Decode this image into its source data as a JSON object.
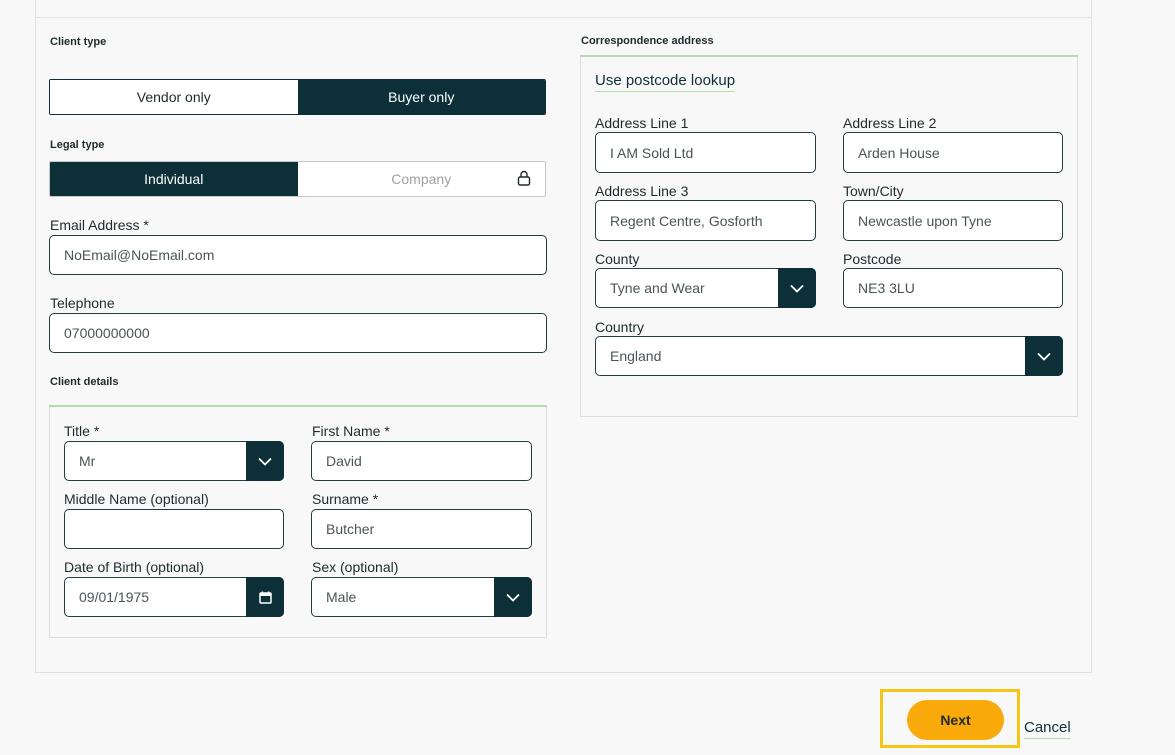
{
  "client_type": {
    "label": "Client type",
    "options": [
      "Vendor only",
      "Buyer only"
    ],
    "selected": "Buyer only"
  },
  "legal_type": {
    "label": "Legal type",
    "options": [
      "Individual",
      "Company"
    ],
    "selected": "Individual"
  },
  "email": {
    "label": "Email Address *",
    "value": "NoEmail@NoEmail.com"
  },
  "telephone": {
    "label": "Telephone",
    "value": "07000000000"
  },
  "client_details": {
    "label": "Client details",
    "title": {
      "label": "Title *",
      "value": "Mr"
    },
    "first_name": {
      "label": "First Name *",
      "value": "David"
    },
    "middle_name": {
      "label": "Middle Name (optional)",
      "value": ""
    },
    "surname": {
      "label": "Surname *",
      "value": "Butcher"
    },
    "dob": {
      "label": "Date of Birth (optional)",
      "value": "09/01/1975"
    },
    "sex": {
      "label": "Sex (optional)",
      "value": "Male"
    }
  },
  "correspondence": {
    "label": "Correspondence address",
    "lookup_link": "Use postcode lookup",
    "address_line_1": {
      "label": "Address Line 1",
      "value": "I AM Sold Ltd"
    },
    "address_line_2": {
      "label": "Address Line 2",
      "value": "Arden House"
    },
    "address_line_3": {
      "label": "Address Line 3",
      "value": "Regent Centre, Gosforth"
    },
    "town": {
      "label": "Town/City",
      "value": "Newcastle upon Tyne"
    },
    "county": {
      "label": "County",
      "value": "Tyne and Wear"
    },
    "postcode": {
      "label": "Postcode",
      "value": "NE3 3LU"
    },
    "country": {
      "label": "Country",
      "value": "England"
    }
  },
  "actions": {
    "next": "Next",
    "cancel": "Cancel"
  },
  "colors": {
    "primary": "#0d3038",
    "accent": "#f9a90a",
    "highlight": "#f5c518",
    "rule": "#b5dcae"
  }
}
